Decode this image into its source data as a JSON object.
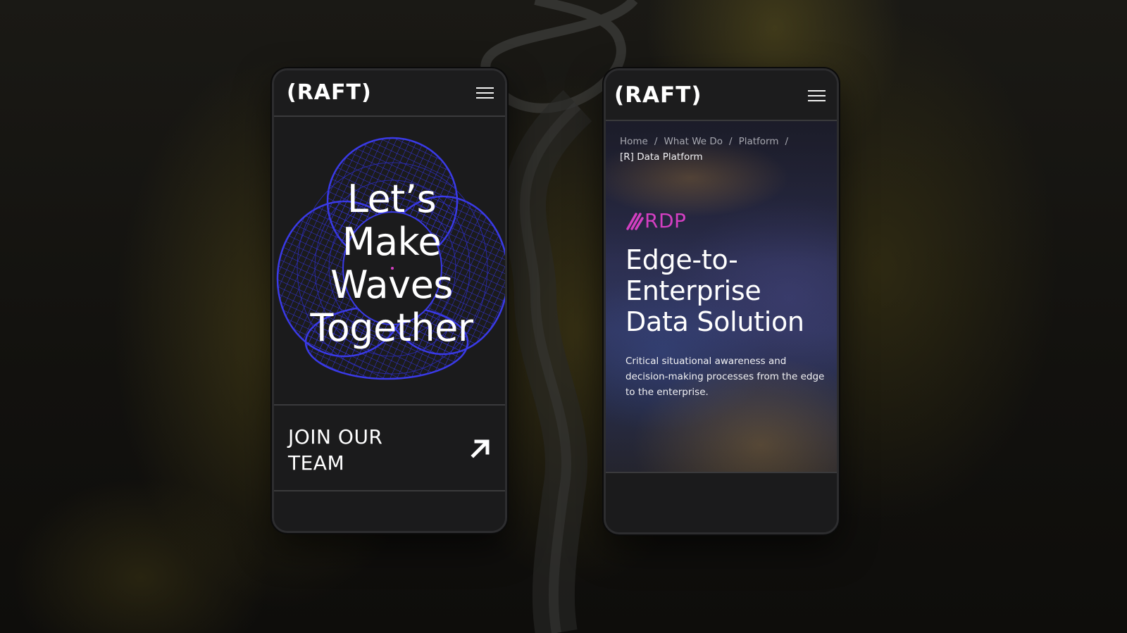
{
  "brand": {
    "logo_text": "(RAFT)"
  },
  "left_phone": {
    "hero_title_lines": [
      "Let’s",
      "Make",
      "Waves",
      "Together"
    ],
    "join_label": "JOIN OUR TEAM",
    "menu_icon": "hamburger-menu-icon",
    "arrow_icon": "arrow-up-right-icon"
  },
  "right_phone": {
    "breadcrumb": {
      "items": [
        "Home",
        "What We Do",
        "Platform"
      ],
      "separator": "/",
      "current": "[R] Data Platform"
    },
    "product_logo": "RDP",
    "title_lines": [
      "Edge-to-",
      "Enterprise",
      "Data Solution"
    ],
    "description": "Critical situational awareness and decision-making processes from the edge to the enterprise.",
    "menu_icon": "hamburger-menu-icon"
  },
  "colors": {
    "accent_magenta": "#d43fc2",
    "wireframe_blue": "#2f2fd8",
    "panel_bg": "#1b1b1c",
    "text_primary": "#ffffff"
  }
}
